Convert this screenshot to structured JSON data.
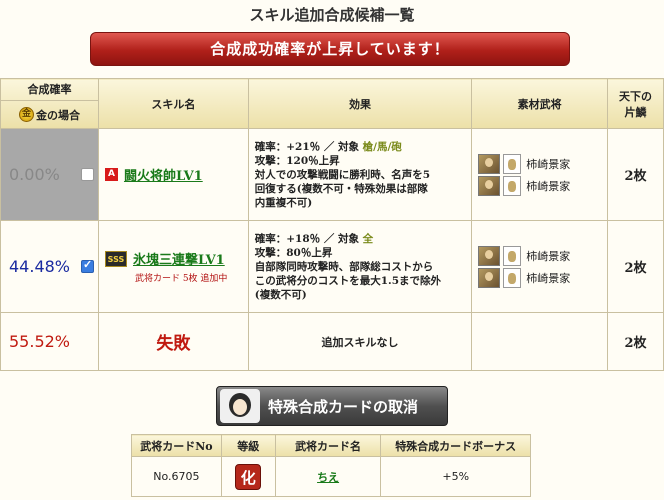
{
  "title": "スキル追加合成候補一覧",
  "banner": "合成成功確率が上昇しています！",
  "headers": {
    "rate_top": "合成確率",
    "rate_bottom": "金の場合",
    "gold_glyph": "金",
    "skill": "スキル名",
    "effect": "効果",
    "material": "素材武将",
    "tenka_line1": "天下の",
    "tenka_line2": "片鱗"
  },
  "rows": [
    {
      "rate": "0.00%",
      "rate_color": "#888888",
      "checked": false,
      "rank": "A",
      "skill": "闘火将帥LV1",
      "note": "",
      "effect": {
        "l1_prefix": "確率：+21％ ／ 対象",
        "l1_target": "槍/馬/砲",
        "l2": "攻撃：120％上昇",
        "l3": "対人での攻撃戦闘に勝利時、名声を5",
        "l4": "回復する(複数不可・特殊効果は部隊",
        "l5": "内重複不可)"
      },
      "materials": [
        "柿崎景家",
        "柿崎景家"
      ],
      "count": "2枚"
    },
    {
      "rate": "44.48%",
      "rate_color": "#1a2aa0",
      "checked": true,
      "rank": "SSS",
      "skill": "氷塊三連撃LV1",
      "note": "武将カード 5枚 追加中",
      "effect": {
        "l1_prefix": "確率：+18％ ／ 対象",
        "l1_target": "全",
        "l2": "攻撃：80％上昇",
        "l3": "自部隊同時攻撃時、部隊総コストから",
        "l4": "この武将分のコストを最大1.5まで除外",
        "l5": "(複数不可)"
      },
      "materials": [
        "柿崎景家",
        "柿崎景家"
      ],
      "count": "2枚"
    },
    {
      "rate": "55.52%",
      "rate_color": "#c01a10",
      "skill": "失敗",
      "effect_text": "追加スキルなし",
      "count": "2枚"
    }
  ],
  "cancel_button": "特殊合成カードの取消",
  "card_table": {
    "headers": [
      "武将カードNo",
      "等級",
      "武将カード名",
      "特殊合成カードボーナス"
    ],
    "no": "No.6705",
    "grade": "化",
    "name": "ちえ",
    "bonus": "+5%"
  },
  "colors": {
    "banner": "#b0201a",
    "header_bg": "#ece0a8",
    "row1_rate_bg": "#a8a8a8",
    "skill_link": "#1a7a1a"
  }
}
